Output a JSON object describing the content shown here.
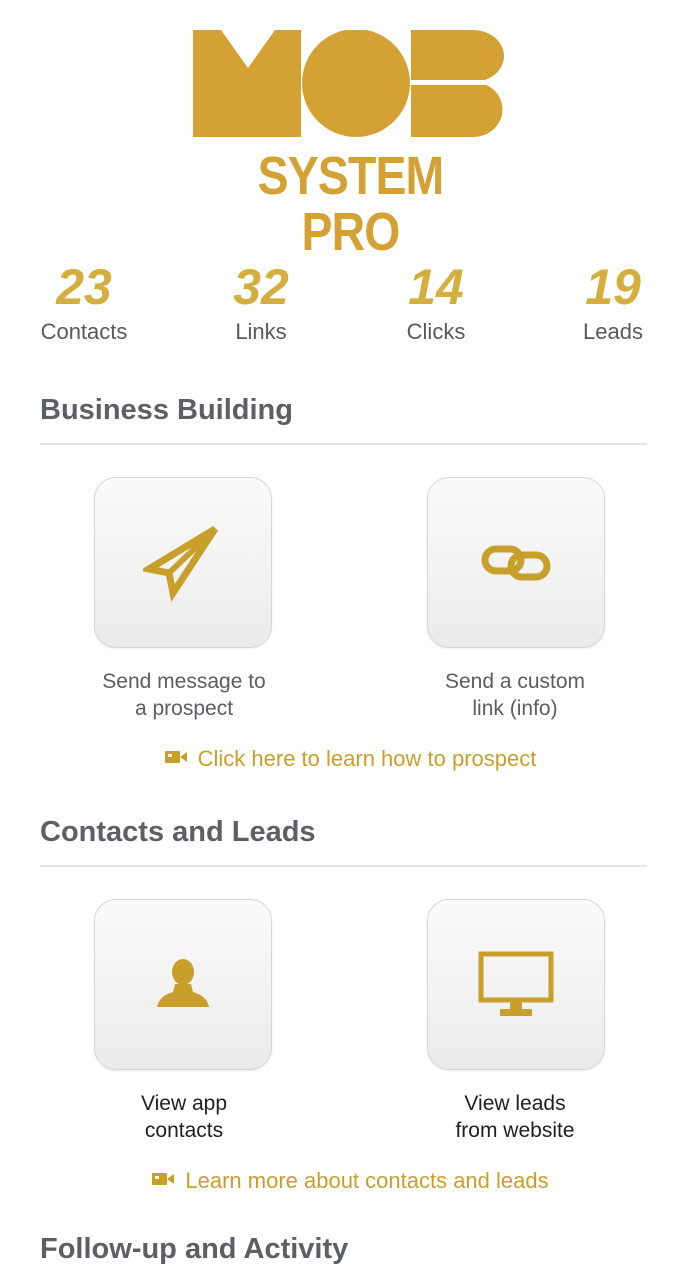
{
  "brand": {
    "logo_top": "MOB",
    "logo_bottom": "SYSTEM PRO",
    "color": "#d4a234"
  },
  "stats": [
    {
      "value": "23",
      "label": "Contacts"
    },
    {
      "value": "32",
      "label": "Links"
    },
    {
      "value": "14",
      "label": "Clicks"
    },
    {
      "value": "19",
      "label": "Leads"
    }
  ],
  "sections": {
    "business": {
      "title": "Business Building",
      "tiles": [
        {
          "icon": "paper-plane-icon",
          "label_line1": "Send message to",
          "label_line2": "a prospect"
        },
        {
          "icon": "link-icon",
          "label_line1": "Send a custom",
          "label_line2": "link (info)"
        }
      ],
      "learn_link": "Click here to learn how to prospect"
    },
    "contacts": {
      "title": "Contacts and Leads",
      "tiles": [
        {
          "icon": "user-icon",
          "label_line1": "View app",
          "label_line2": "contacts"
        },
        {
          "icon": "monitor-icon",
          "label_line1": "View leads",
          "label_line2": "from website"
        }
      ],
      "learn_link": "Learn more about contacts and leads"
    },
    "next": {
      "title": "Follow-up and Activity"
    }
  }
}
